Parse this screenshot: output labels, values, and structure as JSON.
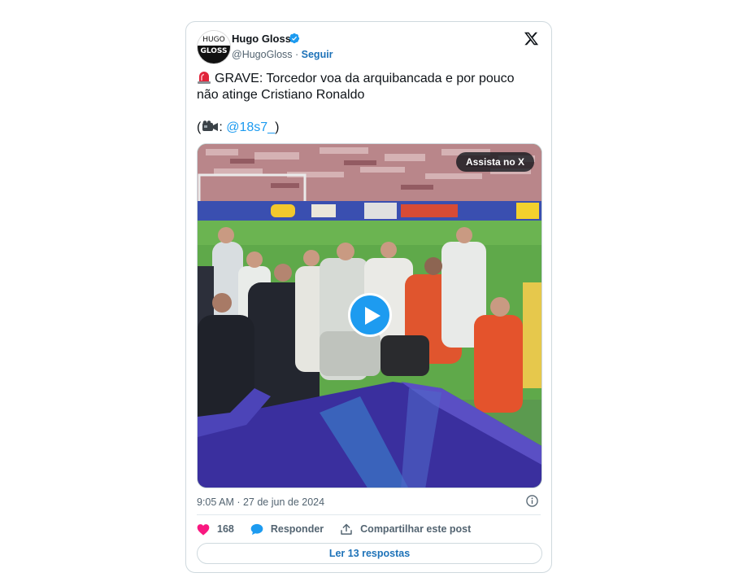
{
  "author": {
    "name": "Hugo Gloss",
    "handle": "@HugoGloss",
    "separator": " · ",
    "follow_label": "Seguir",
    "avatar_text_top": "HUGO",
    "avatar_text_bottom": "GLOSS",
    "verified_color": "#1d9bf0"
  },
  "platform_icon": "x-logo-icon",
  "tweet": {
    "line1": "GRAVE: Torcedor voa da arquibancada e por pouco",
    "line2": "não atinge Cristiano Ronaldo",
    "credit_prefix": "(",
    "credit_colon": ": ",
    "credit_mention": "@18s7_",
    "credit_suffix": ")"
  },
  "media": {
    "watch_label": "Assista no X",
    "play_icon": "play-icon",
    "accent": "#1d9bf0"
  },
  "timestamp": "9:05 AM · 27 de jun de 2024",
  "actions": {
    "likes": "168",
    "reply_label": "Responder",
    "share_label": "Compartilhar este post",
    "like_color": "#f91880"
  },
  "read_replies": "Ler 13 respostas"
}
